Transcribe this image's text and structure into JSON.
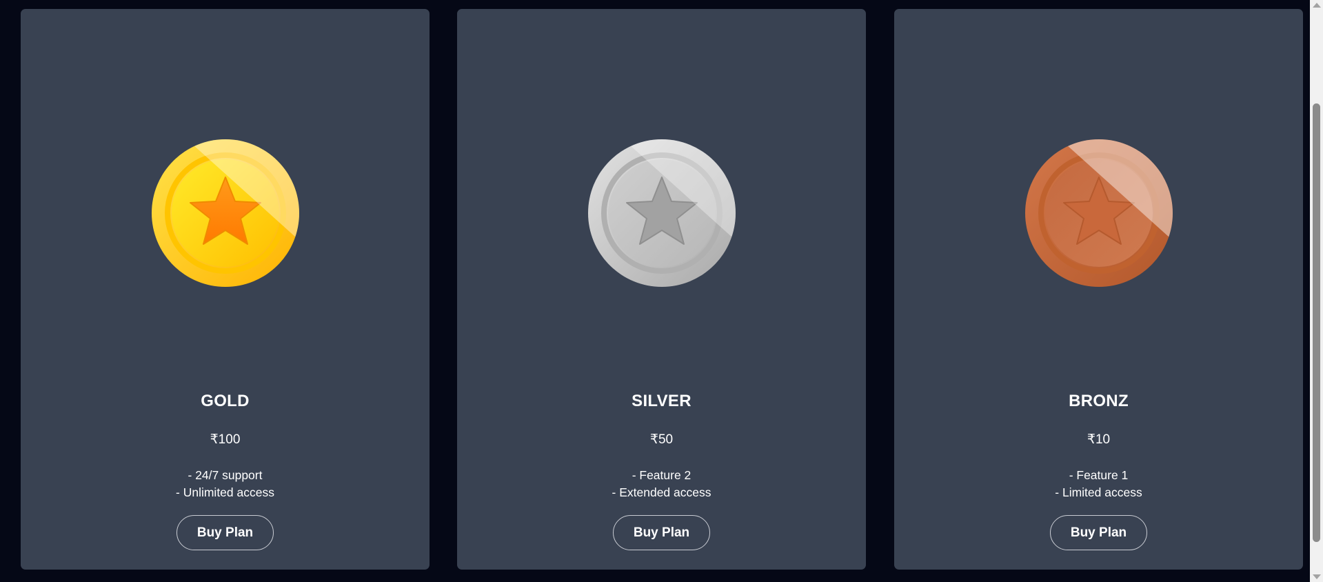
{
  "colors": {
    "page_background": "#050816",
    "card_background": "#394252",
    "text": "#ffffff",
    "button_border": "#c9ccd3"
  },
  "plans": [
    {
      "name": "GOLD",
      "price": "₹100",
      "features": [
        "- 24/7 support",
        "- Unlimited access"
      ],
      "button_label": "Buy Plan",
      "coin": "gold-star-coin-icon"
    },
    {
      "name": "SILVER",
      "price": "₹50",
      "features": [
        "- Feature 2",
        "- Extended access"
      ],
      "button_label": "Buy Plan",
      "coin": "silver-star-coin-icon"
    },
    {
      "name": "BRONZ",
      "price": "₹10",
      "features": [
        "- Feature 1",
        "- Limited access"
      ],
      "button_label": "Buy Plan",
      "coin": "bronze-star-coin-icon"
    }
  ]
}
